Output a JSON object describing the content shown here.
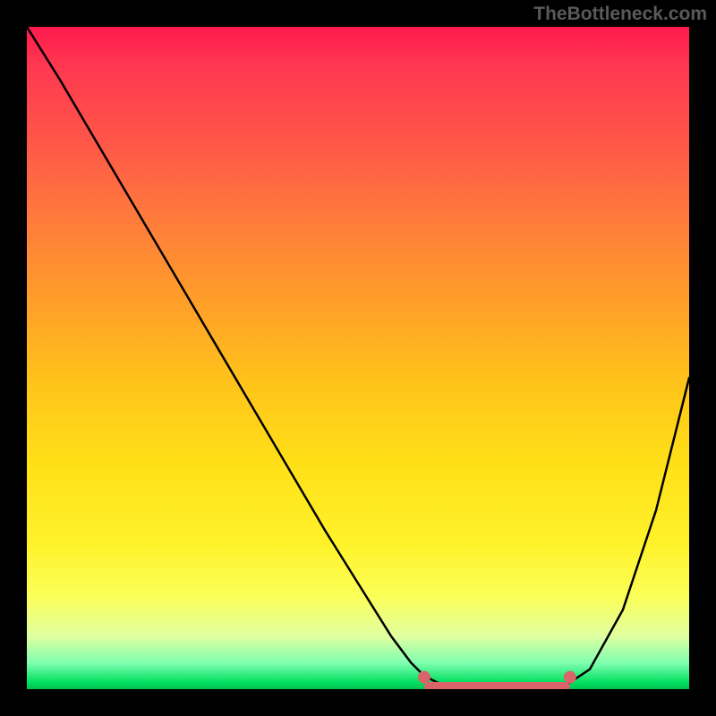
{
  "watermark": "TheBottleneck.com",
  "chart_data": {
    "type": "line",
    "title": "",
    "xlabel": "",
    "ylabel": "",
    "xlim": [
      0,
      100
    ],
    "ylim": [
      0,
      100
    ],
    "grid": false,
    "legend": false,
    "annotations": [],
    "series": [
      {
        "name": "curve",
        "x": [
          0,
          5,
          10,
          15,
          20,
          25,
          30,
          35,
          40,
          45,
          50,
          55,
          58,
          60,
          62,
          65,
          70,
          75,
          80,
          82,
          85,
          90,
          95,
          100
        ],
        "y": [
          100,
          92,
          83.5,
          75,
          66.5,
          58,
          49.5,
          41,
          32.5,
          24,
          16,
          8,
          4,
          2,
          1,
          0,
          0,
          0,
          0,
          1,
          3,
          12,
          27,
          47
        ]
      }
    ],
    "highlight_band": {
      "name": "optimal-range",
      "start_x": 60,
      "end_x": 82,
      "y": 0
    },
    "end_markers": [
      {
        "x": 60,
        "y": 1.8
      },
      {
        "x": 82,
        "y": 1.8
      }
    ],
    "color_gradient": {
      "top": "#ff1a4d",
      "mid": "#ffe018",
      "bottom": "#00c050"
    }
  }
}
